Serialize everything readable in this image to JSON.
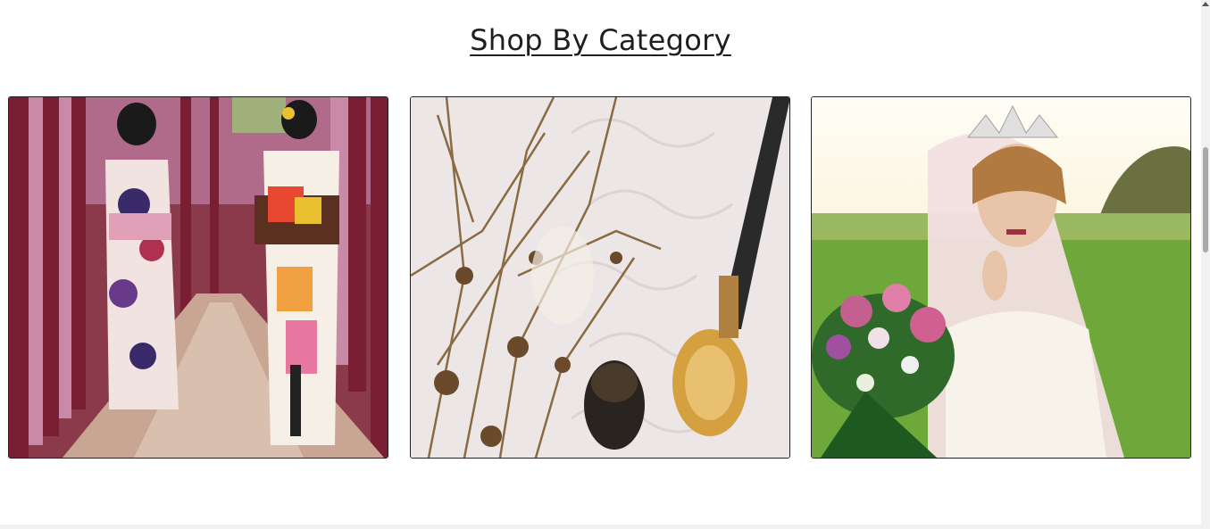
{
  "section": {
    "title": "Shop By Category"
  },
  "categories": [
    {
      "name": "kimono-category-card"
    },
    {
      "name": "incense-category-card"
    },
    {
      "name": "bridal-category-card"
    }
  ],
  "colors": {
    "background": "#ffffff",
    "title": "#1f1f1f",
    "border": "#222222"
  }
}
